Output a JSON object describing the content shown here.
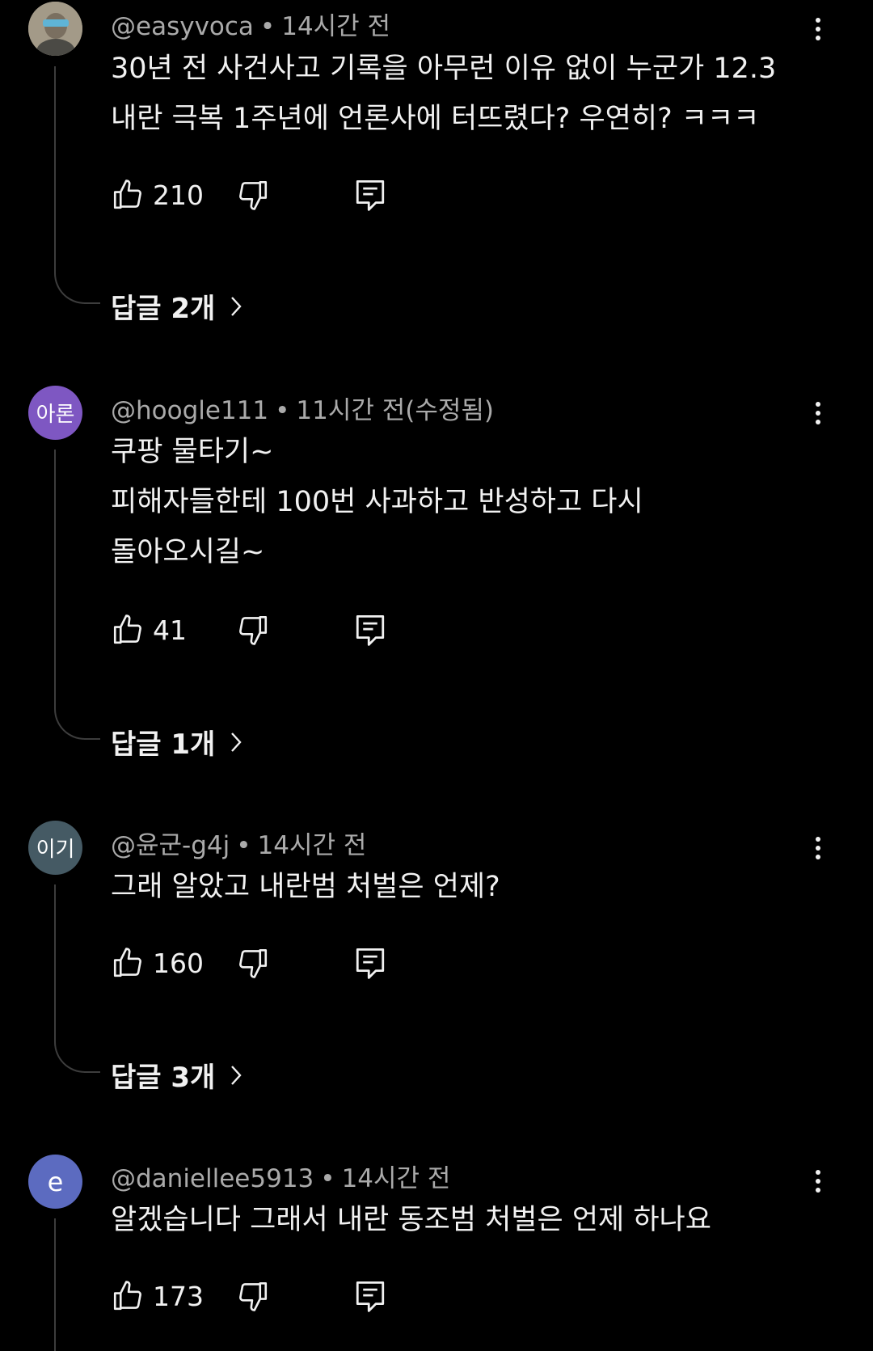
{
  "comments": [
    {
      "author": "@easyvoca",
      "time": "14시간 전",
      "avatar_text": "",
      "avatar_color": "#9d9483",
      "lines": [
        "30년 전 사건사고 기록을 아무런 이유 없이 누군가 12.3",
        "내란 극복 1주년에 언론사에 터뜨렸다? 우연히? ㅋㅋㅋ"
      ],
      "likes": "210",
      "replies_label": "답글 2개"
    },
    {
      "author": "@hoogle111",
      "time": "11시간 전(수정됨)",
      "avatar_text": "아론",
      "avatar_color": "#7e57c2",
      "lines": [
        "쿠팡 물타기~",
        "피해자들한테 100번 사과하고 반성하고 다시",
        "돌아오시길~"
      ],
      "likes": "41",
      "replies_label": "답글 1개"
    },
    {
      "author": "@윤군-g4j",
      "time": "14시간 전",
      "avatar_text": "이기",
      "avatar_color": "#455a64",
      "lines": [
        "그래 알았고 내란범 처벌은 언제?"
      ],
      "likes": "160",
      "replies_label": "답글 3개"
    },
    {
      "author": "@daniellee5913",
      "time": "14시간 전",
      "avatar_text": "e",
      "avatar_color": "#5c6bc0",
      "lines": [
        "알겠습니다 그래서 내란 동조범 처벌은 언제 하나요"
      ],
      "likes": "173",
      "replies_label": ""
    }
  ],
  "icons": {
    "like": "thumbs-up-icon",
    "dislike": "thumbs-down-icon",
    "reply": "reply-comment-icon",
    "more": "more-vert-icon",
    "chevron": "chevron-right-icon"
  },
  "colors": {
    "background": "#000000",
    "text": "#f1f1f1",
    "meta": "#aaaaaa",
    "thread_line": "#3d3d3d"
  }
}
